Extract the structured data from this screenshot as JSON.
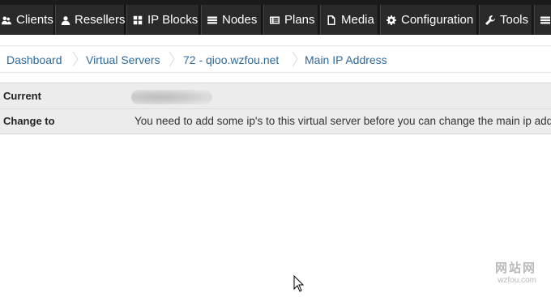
{
  "nav": {
    "items": [
      {
        "label": "Clients",
        "icon": "users-icon"
      },
      {
        "label": "Resellers",
        "icon": "user-icon"
      },
      {
        "label": "IP Blocks",
        "icon": "grid-icon"
      },
      {
        "label": "Nodes",
        "icon": "server-icon"
      },
      {
        "label": "Plans",
        "icon": "list-icon"
      },
      {
        "label": "Media",
        "icon": "file-icon"
      },
      {
        "label": "Configuration",
        "icon": "cog-icon"
      },
      {
        "label": "Tools",
        "icon": "wrench-icon"
      },
      {
        "label": "",
        "icon": "menu-icon"
      }
    ]
  },
  "breadcrumb": [
    {
      "label": "Dashboard"
    },
    {
      "label": "Virtual Servers"
    },
    {
      "label": "72 - qioo.wzfou.net"
    },
    {
      "label": "Main IP Address"
    }
  ],
  "info": {
    "current_label": "Current",
    "change_label": "Change to",
    "change_message": "You need to add some ip's to this virtual server before you can change the main ip address."
  },
  "watermark": {
    "title": "网站网",
    "url": "wzfou.com"
  },
  "colors": {
    "nav_bg": "#1b1b1b",
    "nav_item_bg": "#2a2a2a",
    "link": "#2c6a9e",
    "table_bg": "#ececec"
  }
}
